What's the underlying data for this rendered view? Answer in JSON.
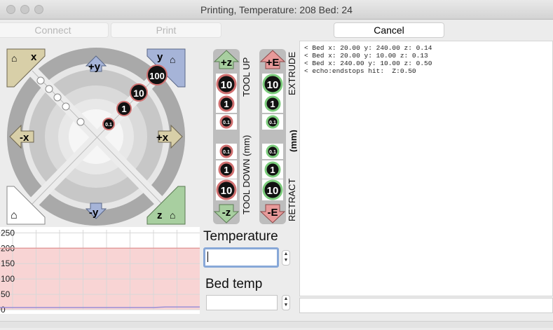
{
  "window": {
    "title": "Printing, Temperature: 208 Bed: 24"
  },
  "toolbar": {
    "connect_label": "Connect",
    "print_label": "Print",
    "cancel_label": "Cancel"
  },
  "jog": {
    "home_x": "x",
    "home_y": "y",
    "home_z": "z",
    "plus_y": "+y",
    "minus_y": "-y",
    "plus_x": "+x",
    "minus_x": "-x",
    "steps": [
      "0.1",
      "1",
      "10",
      "100"
    ]
  },
  "z_axis": {
    "plus_z": "+z",
    "minus_z": "-z",
    "plus_e": "+E",
    "minus_e": "-E",
    "tool_up": "TOOL UP",
    "tool_down": "TOOL DOWN (mm)",
    "extrude": "EXTRUDE",
    "retract": "RETRACT",
    "mm": "(mm)",
    "steps_up": [
      "10",
      "1",
      "0.1"
    ],
    "steps_down": [
      "0.1",
      "1",
      "10"
    ]
  },
  "temperature": {
    "label": "Temperature",
    "value": ""
  },
  "bed": {
    "label": "Bed temp",
    "value": ""
  },
  "log": [
    "< Bed x: 20.00 y: 240.00 z: 0.14",
    "< Bed x: 20.00 y: 10.00 z: 0.13",
    "< Bed x: 240.00 y: 10.00 z: 0.50",
    "< echo:endstops hit:  Z:0.50"
  ],
  "chart_data": {
    "type": "line",
    "yticks": [
      0,
      50,
      100,
      150,
      200,
      250
    ],
    "ylim": [
      0,
      260
    ],
    "series": [
      {
        "color": "#9a8fd8",
        "values": [
          7,
          7,
          7,
          7,
          7,
          7,
          7,
          7,
          7,
          7,
          7,
          7,
          7,
          7,
          7,
          7,
          7,
          7,
          7,
          7,
          7,
          7,
          7,
          7,
          7,
          7,
          7,
          7,
          8,
          9,
          9,
          9,
          9,
          9,
          9,
          9
        ]
      },
      {
        "color": "#e39c9c",
        "values": [
          200,
          200,
          200,
          200,
          200,
          200,
          200,
          200,
          200,
          200,
          200,
          200,
          200,
          200,
          200,
          200,
          200,
          200,
          200,
          200,
          200,
          200,
          200,
          200,
          200,
          200,
          200,
          200,
          200,
          200,
          200,
          200,
          200,
          200,
          200,
          200
        ]
      }
    ],
    "target_fill": "#f8d4d4"
  }
}
